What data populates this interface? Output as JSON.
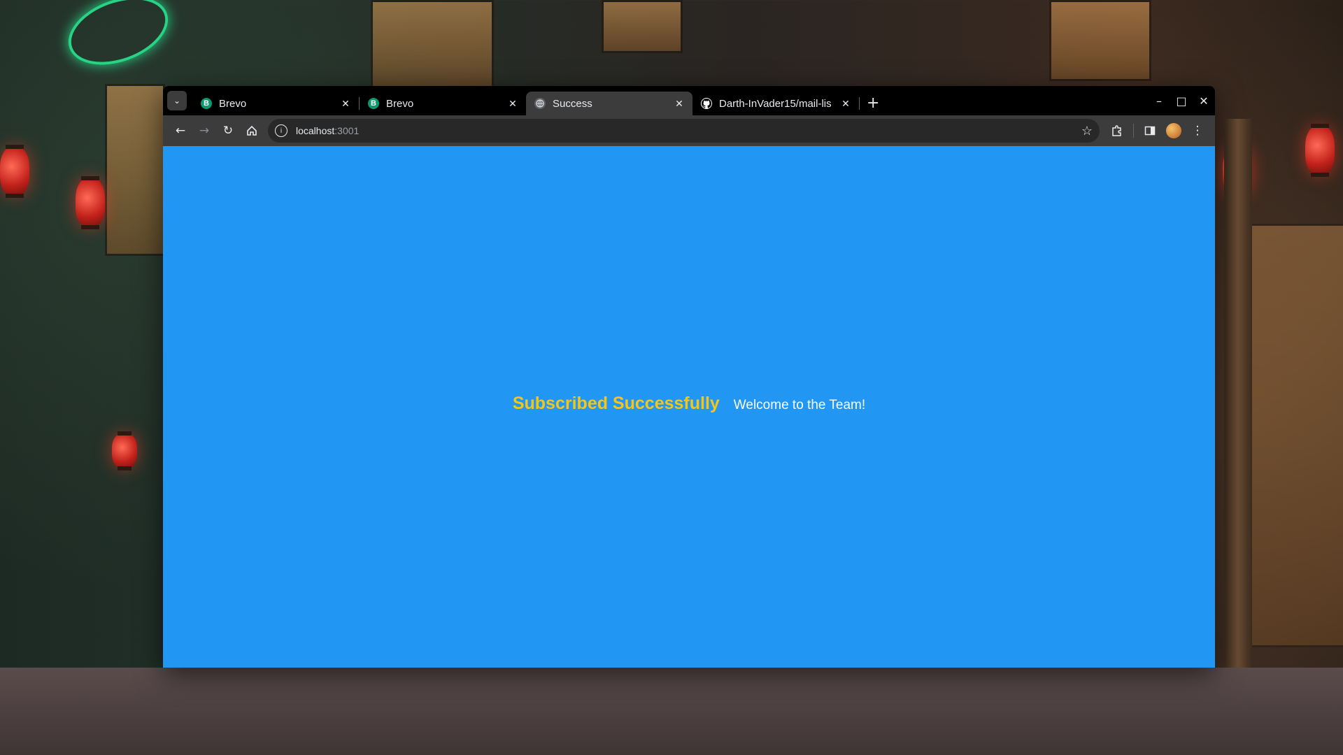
{
  "browser": {
    "tabs": [
      {
        "label": "Brevo",
        "favicon": "brevo-icon",
        "favicon_text": "B",
        "active": false
      },
      {
        "label": "Brevo",
        "favicon": "brevo-icon",
        "favicon_text": "B",
        "active": false
      },
      {
        "label": "Success",
        "favicon": "globe-icon",
        "active": true
      },
      {
        "label": "Darth-InVader15/mail-lis",
        "favicon": "github-icon",
        "active": false
      }
    ],
    "new_tab_label": "+",
    "address": {
      "host": "localhost",
      "port": ":3001"
    },
    "window_controls": {
      "minimize": "–",
      "maximize": "□",
      "close": "✕"
    }
  },
  "page": {
    "title": "Subscribed Successfully",
    "subtitle": "Welcome to the Team!",
    "background_color": "#2196f3",
    "title_color": "#f5c518"
  }
}
